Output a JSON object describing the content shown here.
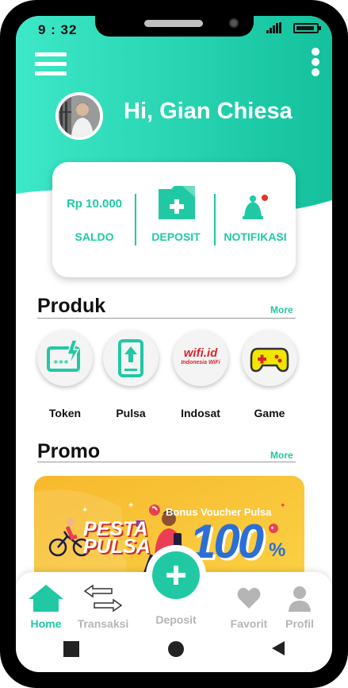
{
  "status_bar": {
    "time": "9 : 32"
  },
  "user": {
    "greeting": "Hi, Gian Chiesa"
  },
  "wallet": {
    "saldo_value": "Rp 10.000",
    "saldo_label": "SALDO",
    "deposit_label": "DEPOSIT",
    "notifikasi_label": "NOTIFIKASI"
  },
  "produk": {
    "title": "Produk",
    "more": "More",
    "items": [
      {
        "label": "Token",
        "icon": "token-card-icon"
      },
      {
        "label": "Pulsa",
        "icon": "phone-upload-icon"
      },
      {
        "label": "Indosat",
        "icon": "wifi-id-logo",
        "logo_text": "wifi.id",
        "logo_sub": "Indonesia WiFi"
      },
      {
        "label": "Game",
        "icon": "gamepad-icon"
      }
    ]
  },
  "promo": {
    "title": "Promo",
    "more": "More",
    "banner": {
      "headline_1": "PESTA",
      "headline_2": "PULSA",
      "bonus_text": "Bonus Voucher Pulsa",
      "big_number": "100",
      "percent": "%"
    }
  },
  "bottom_nav": {
    "items": [
      {
        "label": "Home",
        "icon": "home-icon"
      },
      {
        "label": "Transaksi",
        "icon": "transfer-arrows-icon"
      },
      {
        "label": "Deposit",
        "icon": "plus-icon"
      },
      {
        "label": "Favorit",
        "icon": "heart-icon"
      },
      {
        "label": "Profil",
        "icon": "user-icon"
      }
    ]
  },
  "colors": {
    "accent": "#20c9a4",
    "header_gradient_start": "#3de8c8",
    "header_gradient_end": "#14c19c",
    "promo_yellow": "#f9c635",
    "wifi_red": "#d9262c",
    "game_yellow": "#f2e600",
    "nav_inactive": "#b5b5b5"
  }
}
